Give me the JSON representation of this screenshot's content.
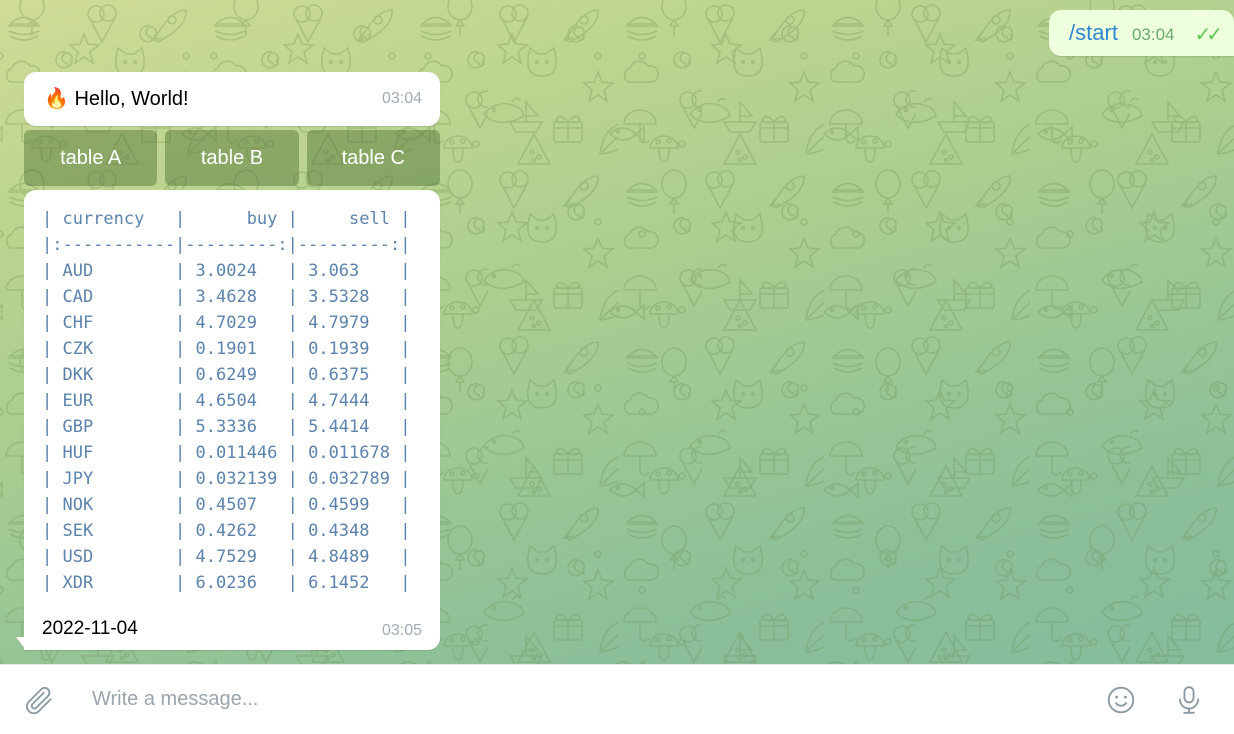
{
  "messages": {
    "outgoing": {
      "text": "/start",
      "time": "03:04",
      "status_icon": "double-check-icon",
      "status_glyph": "✓✓"
    },
    "hello": {
      "emoji": "🔥",
      "emoji_name": "fire-emoji",
      "text": "Hello, World!",
      "time": "03:04"
    },
    "keyboard": {
      "buttons": [
        {
          "label": "table A"
        },
        {
          "label": "table B"
        },
        {
          "label": "table C"
        }
      ]
    },
    "table_message": {
      "date": "2022-11-04",
      "time": "03:05",
      "table_text": "| currency   |      buy |     sell |\n|:-----------|---------:|---------:|\n| AUD        | 3.0024   | 3.063    |\n| CAD        | 3.4628   | 3.5328   |\n| CHF        | 4.7029   | 4.7979   |\n| CZK        | 0.1901   | 0.1939   |\n| DKK        | 0.6249   | 0.6375   |\n| EUR        | 4.6504   | 4.7444   |\n| GBP        | 5.3336   | 5.4414   |\n| HUF        | 0.011446 | 0.011678 |\n| JPY        | 0.032139 | 0.032789 |\n| NOK        | 0.4507   | 0.4599   |\n| SEK        | 0.4262   | 0.4348   |\n| USD        | 4.7529   | 4.8489   |\n| XDR        | 6.0236   | 6.1452   |",
      "columns": [
        "currency",
        "buy",
        "sell"
      ],
      "alignments": [
        "left",
        "right",
        "right"
      ],
      "rows": [
        [
          "AUD",
          "3.0024",
          "3.063"
        ],
        [
          "CAD",
          "3.4628",
          "3.5328"
        ],
        [
          "CHF",
          "4.7029",
          "4.7979"
        ],
        [
          "CZK",
          "0.1901",
          "0.1939"
        ],
        [
          "DKK",
          "0.6249",
          "0.6375"
        ],
        [
          "EUR",
          "4.6504",
          "4.7444"
        ],
        [
          "GBP",
          "5.3336",
          "5.4414"
        ],
        [
          "HUF",
          "0.011446",
          "0.011678"
        ],
        [
          "JPY",
          "0.032139",
          "0.032789"
        ],
        [
          "NOK",
          "0.4507",
          "0.4599"
        ],
        [
          "SEK",
          "0.4262",
          "0.4348"
        ],
        [
          "USD",
          "4.7529",
          "4.8489"
        ],
        [
          "XDR",
          "6.0236",
          "6.1452"
        ]
      ]
    }
  },
  "composer": {
    "placeholder": "Write a message...",
    "value": "",
    "attach_icon": "paperclip-icon",
    "emoji_icon": "smiley-icon",
    "mic_icon": "microphone-icon"
  },
  "theme": {
    "outgoing_bubble": "#eeffde",
    "incoming_bubble": "#ffffff",
    "command_link": "#2f88d0",
    "mono_text": "#5b83ad",
    "keyboard_button": "rgba(70,105,42,0.42)",
    "tick_color": "#5dc452",
    "bg_top": "#cfdc98",
    "bg_bottom": "#85bc9c"
  }
}
